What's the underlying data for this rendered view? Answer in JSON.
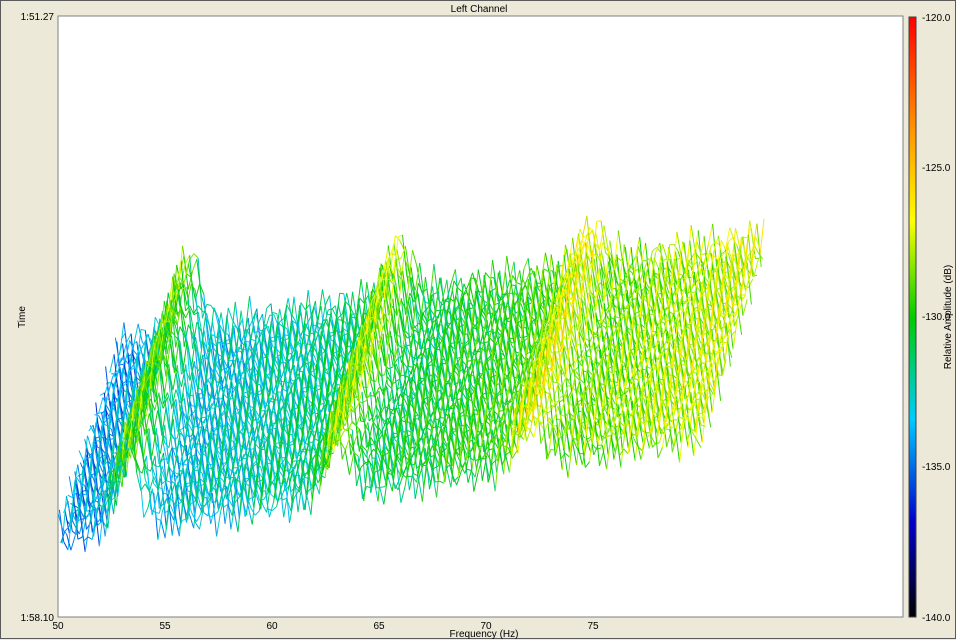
{
  "chart_data": {
    "type": "waterfall-3d",
    "title": "Left Channel",
    "xlabel": "Frequency (Hz)",
    "ylabel": "Time",
    "colorbar_label": "Relative Amplitude (dB)",
    "x_ticks": [
      "50",
      "55",
      "60",
      "65",
      "70",
      "75"
    ],
    "xlim": [
      50,
      80
    ],
    "time_ticks": [
      "1:51.27",
      "1:58.10"
    ],
    "colorbar_ticks": [
      "-120.0",
      "-125.0",
      "-130.0",
      "-135.0",
      "-140.0"
    ],
    "colorbar_range": [
      -140,
      -120
    ],
    "colormap": [
      "#000000",
      "#0000cc",
      "#00ccff",
      "#00cc00",
      "#ffff00",
      "#ff8800",
      "#ff0000"
    ],
    "background_color": "#ffffff",
    "frame_color": "#ece9d8",
    "grid": false
  }
}
